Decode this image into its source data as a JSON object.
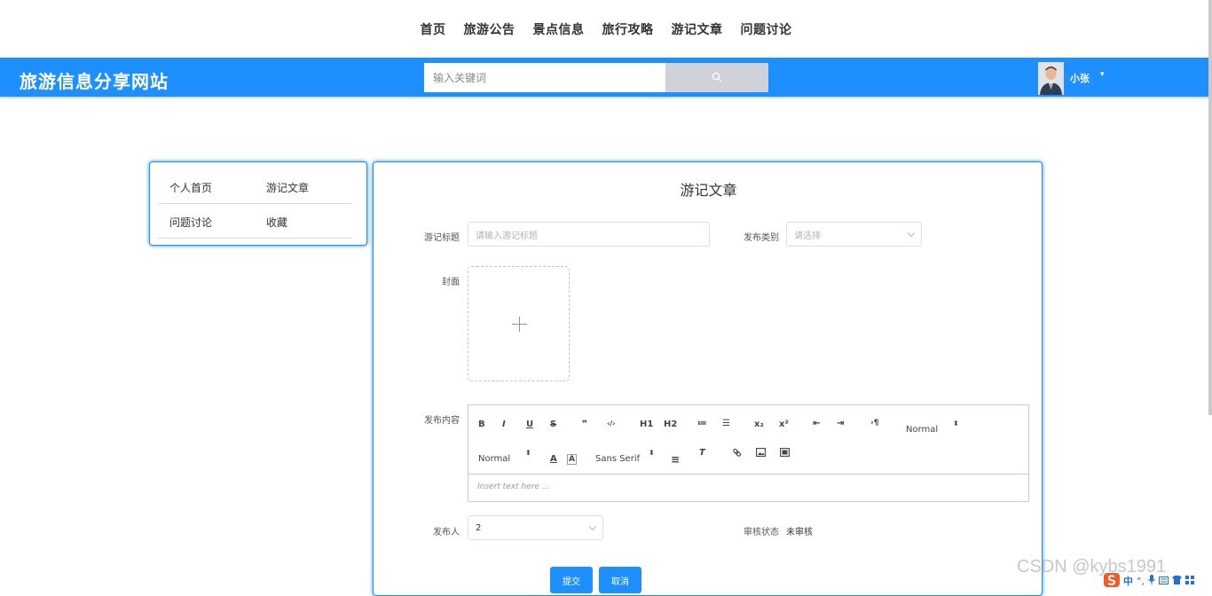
{
  "nav": {
    "items": [
      {
        "label": "首页"
      },
      {
        "label": "旅游公告"
      },
      {
        "label": "景点信息"
      },
      {
        "label": "旅行攻略"
      },
      {
        "label": "游记文章"
      },
      {
        "label": "问题讨论"
      }
    ]
  },
  "header": {
    "site_title": "旅游信息分享网站",
    "search_placeholder": "输入关键词",
    "search_icon": "search-icon",
    "user_name": "小张",
    "user_caret": "▾"
  },
  "sidebar": {
    "rows": [
      {
        "items": [
          {
            "label": "个人首页"
          },
          {
            "label": "游记文章"
          }
        ]
      },
      {
        "items": [
          {
            "label": "问题讨论"
          },
          {
            "label": "收藏"
          }
        ]
      }
    ]
  },
  "form": {
    "title": "游记文章",
    "title_label": "游记标题",
    "title_placeholder": "请输入游记标题",
    "category_label": "发布类别",
    "category_placeholder": "请选择",
    "cover_label": "封面",
    "content_label": "发布内容",
    "editor": {
      "toolbar_row1": [
        "B",
        "I",
        "U",
        "S",
        "❞",
        "‹/›",
        "H1",
        "H2",
        "≔",
        "☰",
        "x₂",
        "x²",
        "⇤",
        "⇥",
        "›¶"
      ],
      "header_select": "Normal",
      "size_select": "Normal",
      "font_select": "Sans Serif",
      "placeholder": "Insert text here ..."
    },
    "publisher_label": "发布人",
    "publisher_value": "2",
    "review_label": "审核状态",
    "review_value": "未审核",
    "submit_label": "提交",
    "cancel_label": "取消"
  },
  "watermark": "CSDN @kybs1991",
  "ime": {
    "label": "中"
  },
  "colors": {
    "brand": "#1e8fff",
    "search_button": "#cfd3d9"
  }
}
